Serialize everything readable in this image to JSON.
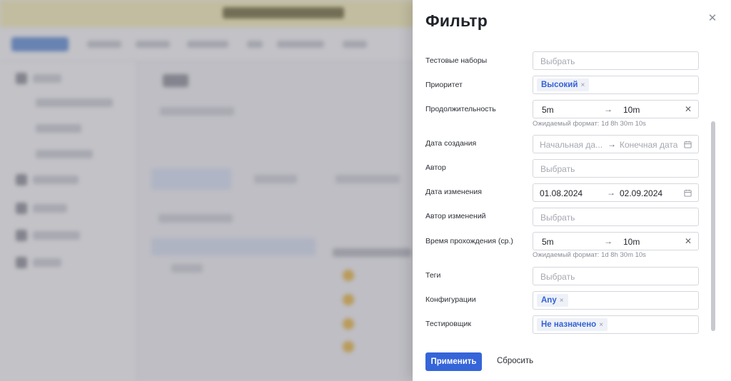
{
  "drawer": {
    "title": "Фильтр",
    "close_icon": "close-icon",
    "rows": {
      "test_suites": {
        "label": "Тестовые наборы",
        "placeholder": "Выбрать"
      },
      "priority": {
        "label": "Приоритет",
        "chip": "Высокий"
      },
      "duration": {
        "label": "Продолжительность",
        "from": "5m",
        "to": "10m",
        "hint": "Ожидаемый формат: 1d 8h 30m 10s"
      },
      "created_date": {
        "label": "Дата создания",
        "from_placeholder": "Начальная да...",
        "to_placeholder": "Конечная дата"
      },
      "author": {
        "label": "Автор",
        "placeholder": "Выбрать"
      },
      "modified_date": {
        "label": "Дата изменения",
        "from": "01.08.2024",
        "to": "02.09.2024"
      },
      "modified_by": {
        "label": "Автор изменений",
        "placeholder": "Выбрать"
      },
      "avg_run_time": {
        "label": "Время прохождения (ср.)",
        "from": "5m",
        "to": "10m",
        "hint": "Ожидаемый формат: 1d 8h 30m 10s"
      },
      "tags": {
        "label": "Теги",
        "placeholder": "Выбрать"
      },
      "configurations": {
        "label": "Конфигурации",
        "chip": "Any"
      },
      "tester": {
        "label": "Тестировщик",
        "chip": "Не назначено"
      }
    },
    "arrow": "→",
    "clear_symbol": "✕",
    "chip_remove": "×",
    "apply_label": "Применить",
    "reset_label": "Сбросить"
  },
  "colors": {
    "accent": "#3565d8",
    "chip_text": "#3362d6",
    "overlay": "#787882"
  }
}
